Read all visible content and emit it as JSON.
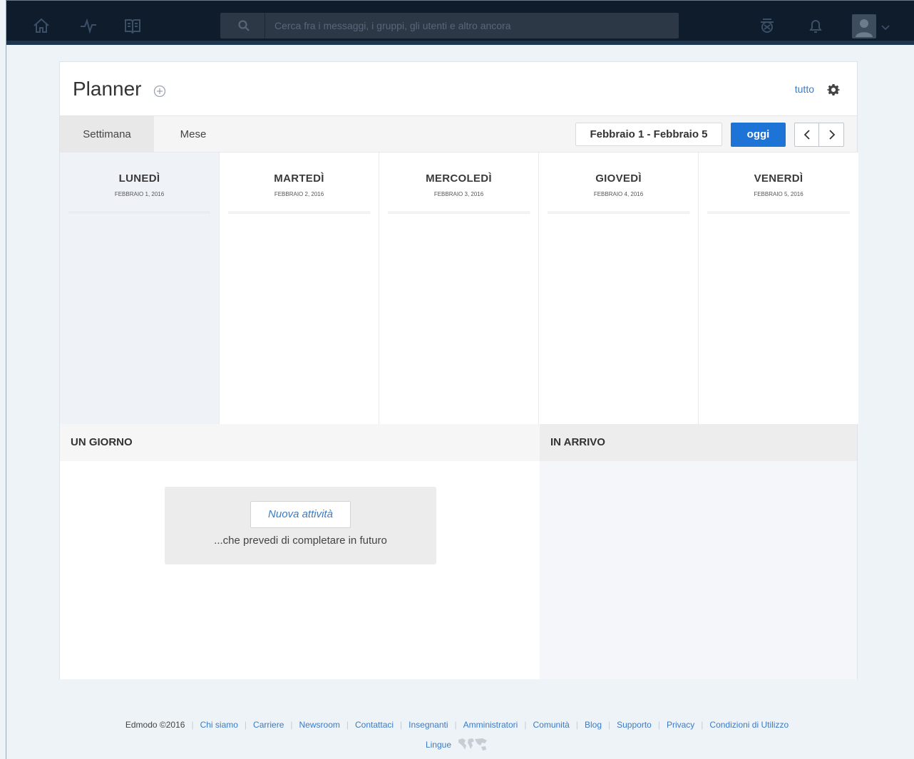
{
  "nav": {
    "search_placeholder": "Cerca fra i messaggi, i gruppi, gli utenti e altro ancora",
    "icons": [
      "home-icon",
      "activity-icon",
      "library-icon",
      "backpack-icon",
      "bell-icon",
      "avatar",
      "chevron-down-icon"
    ]
  },
  "planner": {
    "title": "Planner",
    "filter_label": "tutto",
    "tabs": [
      {
        "label": "Settimana",
        "active": true
      },
      {
        "label": "Mese",
        "active": false
      }
    ],
    "date_range": "Febbraio 1 - Febbraio 5",
    "today_label": "oggi",
    "days": [
      {
        "name": "LUNEDÌ",
        "date": "FEBBRAIO 1, 2016",
        "today": true
      },
      {
        "name": "MARTEDÌ",
        "date": "FEBBRAIO 2, 2016",
        "today": false
      },
      {
        "name": "MERCOLEDÌ",
        "date": "FEBBRAIO 3, 2016",
        "today": false
      },
      {
        "name": "GIOVEDÌ",
        "date": "FEBBRAIO 4, 2016",
        "today": false
      },
      {
        "name": "VENERDÌ",
        "date": "FEBBRAIO 5, 2016",
        "today": false
      }
    ],
    "someday": {
      "heading": "UN GIORNO",
      "new_task_label": "Nuova attività",
      "caption": "...che prevedi di completare in futuro"
    },
    "upcoming": {
      "heading": "IN ARRIVO"
    }
  },
  "footer": {
    "copyright": "Edmodo ©2016",
    "links": [
      "Chi siamo",
      "Carriere",
      "Newsroom",
      "Contattaci",
      "Insegnanti",
      "Amministratori",
      "Comunità",
      "Blog",
      "Supporto",
      "Privacy",
      "Condizioni di Utilizzo"
    ],
    "language_label": "Lingue"
  },
  "colors": {
    "nav_bg": "#0e1c2c",
    "accent_blue": "#1e73d6",
    "link_blue": "#3a7bc4",
    "page_bg": "#eef3f8"
  }
}
